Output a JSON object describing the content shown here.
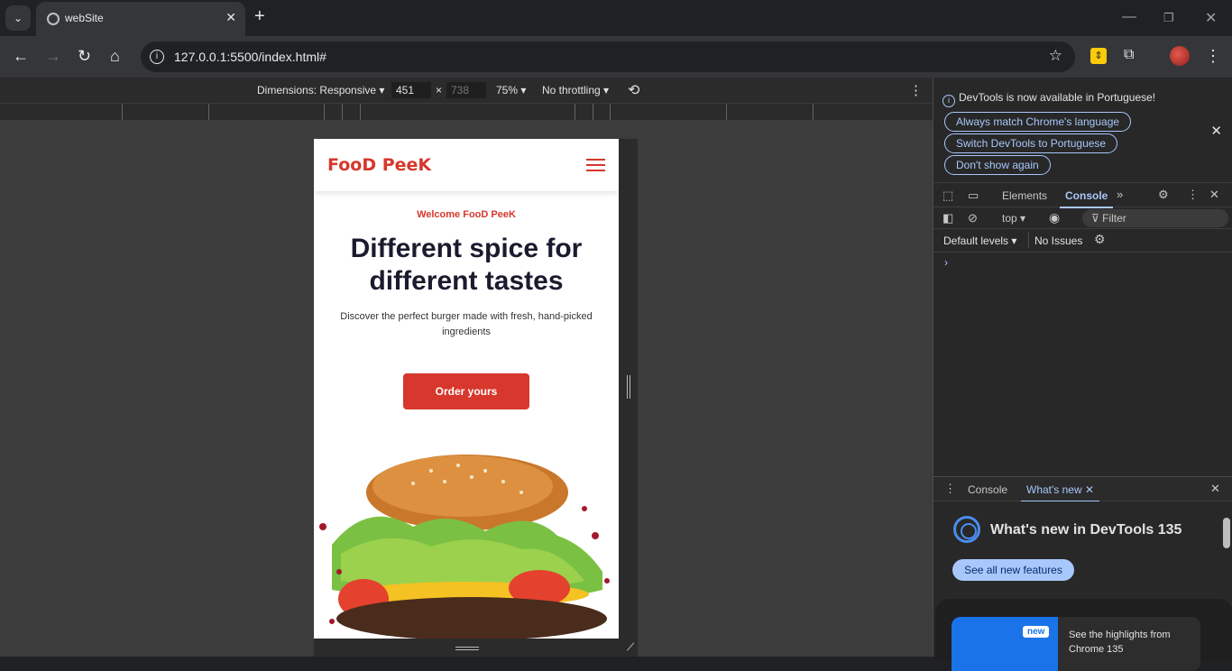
{
  "browser": {
    "tab_title": "webSite",
    "url": "127.0.0.1:5500/index.html#"
  },
  "device_toolbar": {
    "dimensions_label": "Dimensions: Responsive",
    "width": "451",
    "height": "738",
    "zoom": "75%",
    "throttling": "No throttling"
  },
  "site": {
    "logo": "FooD PeeK",
    "welcome": "Welcome FooD PeeK",
    "title": "Different spice for different tastes",
    "description": "Discover the perfect burger made with fresh, hand-picked ingredients",
    "cta": "Order yours",
    "accent": "#d7372c"
  },
  "devtools": {
    "notice": "DevTools is now available in Portuguese!",
    "btn_match": "Always match Chrome's language",
    "btn_switch": "Switch DevTools to Portuguese",
    "btn_dont_show": "Don't show again",
    "tabs": [
      "Elements",
      "Console"
    ],
    "context": "top",
    "filter_placeholder": "Filter",
    "levels": "Default levels",
    "issues": "No Issues",
    "drawer_tabs": [
      "Console",
      "What's new"
    ],
    "whatsnew_title": "What's new in DevTools 135",
    "see_all": "See all new features",
    "badge": "new",
    "highlights": "See the highlights from Chrome 135"
  }
}
